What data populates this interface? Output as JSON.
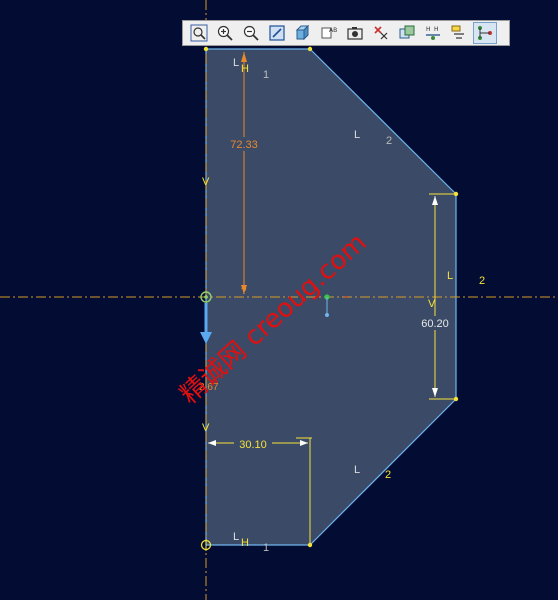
{
  "toolbar": {
    "buttons": [
      {
        "name": "zoom-fit-icon"
      },
      {
        "name": "zoom-in-icon"
      },
      {
        "name": "zoom-out-icon"
      },
      {
        "name": "edit-icon"
      },
      {
        "name": "box-view-icon"
      },
      {
        "name": "text-icon"
      },
      {
        "name": "camera-icon"
      },
      {
        "name": "delete-constraint-icon"
      },
      {
        "name": "copy-icon"
      },
      {
        "name": "dimension-icon"
      },
      {
        "name": "sketch-text-icon"
      },
      {
        "name": "connect-icon",
        "active": true
      }
    ]
  },
  "sketch": {
    "dimensions": {
      "vertical_top": "72.33",
      "right_height": "60.20",
      "bottom_width": "30.10",
      "small": "2.67"
    },
    "constraint_labels": {
      "top_L": "L",
      "top_H": "H",
      "top_1": "1",
      "diag_top_L": "L",
      "diag_top_2": "2",
      "left_V_top": "V",
      "right_L": "L",
      "right_2": "2",
      "right_V": "V",
      "left_V_bottom": "V",
      "diag_bottom_L": "L",
      "diag_bottom_2": "2",
      "bottom_L": "L",
      "bottom_H": "H",
      "bottom_1": "1"
    },
    "watermark": "精诚网 creoug.com"
  },
  "colors": {
    "background": "#030c33",
    "shape_fill": "#3b4a66",
    "edge": "#6fb6ee",
    "dimension_orange": "#e8892a",
    "dimension_yellow": "#f4e13a",
    "axis": "#d49a2a",
    "watermark": "#e01010"
  }
}
